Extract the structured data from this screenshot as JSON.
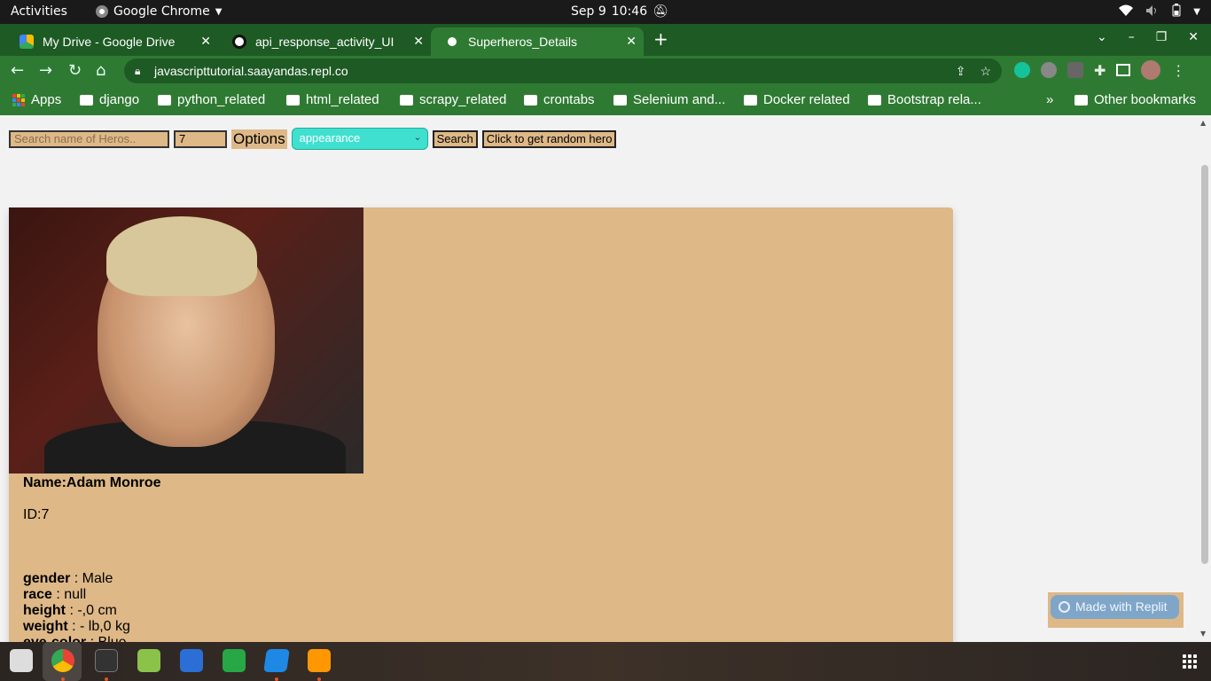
{
  "system": {
    "activities": "Activities",
    "app_name": "Google Chrome",
    "date": "Sep 9",
    "time": "10:46"
  },
  "tabs": [
    {
      "title": "My Drive - Google Drive",
      "active": false
    },
    {
      "title": "api_response_activity_UI",
      "active": false
    },
    {
      "title": "Superheros_Details",
      "active": true
    }
  ],
  "toolbar": {
    "url": "javascripttutorial.saayandas.repl.co"
  },
  "bookmarks": {
    "apps": "Apps",
    "items": [
      "django",
      "python_related",
      "html_related",
      "scrapy_related",
      "crontabs",
      "Selenium and...",
      "Docker related",
      "Bootstrap rela..."
    ],
    "more": "»",
    "other": "Other bookmarks"
  },
  "page": {
    "search_placeholder": "Search name of Heros..",
    "id_value": "7",
    "options_label": "Options",
    "select_value": "appearance",
    "search_button": "Search",
    "random_button": "Click to get random hero",
    "hero": {
      "name_label": "Name:",
      "name": "Adam Monroe",
      "id_label": "ID:",
      "id": "7",
      "attributes": [
        {
          "key": "gender",
          "value": " : Male"
        },
        {
          "key": "race",
          "value": " : null"
        },
        {
          "key": "height",
          "value": " : -,0 cm"
        },
        {
          "key": "weight",
          "value": " : - lb,0 kg"
        },
        {
          "key": "eye-color",
          "value": " : Blue"
        }
      ]
    },
    "replit_badge": "Made with Replit"
  },
  "colors": {
    "chrome_frame": "#1e5a24",
    "chrome_toolbar": "#2f7a33",
    "card_bg": "#deb887",
    "select_bg": "#40e0d0",
    "page_bg": "#f2f2f2"
  },
  "icons": [
    "chrome-icon",
    "drive-icon",
    "github-icon",
    "globe-icon",
    "lock-icon",
    "share-icon",
    "star-icon",
    "grammarly-icon",
    "extension-icon",
    "puzzle-icon",
    "sidebar-icon",
    "profile-avatar",
    "menu-dots-icon",
    "folder-icon",
    "apps-grid-icon",
    "wifi-icon",
    "volume-icon",
    "battery-icon",
    "notifications-off-icon"
  ]
}
